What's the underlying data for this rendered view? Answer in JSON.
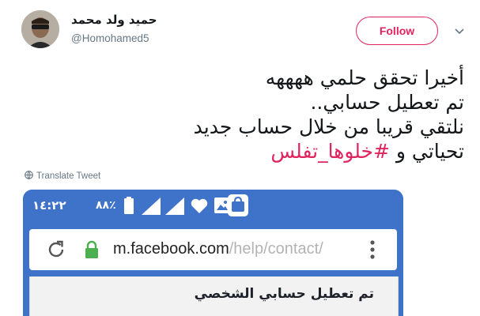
{
  "user": {
    "display_name": "حميد ولد محمد",
    "handle": "@Homohamed5"
  },
  "follow_label": "Follow",
  "tweet": {
    "lines": [
      "أخيرا تحقق حلمي ههههه",
      "تم تعطيل حسابي..",
      "نلتقي قريبا من خلال حساب جديد"
    ],
    "last_line_prefix": "تحياتي و ",
    "hashtag": "#خلوها_تفلس"
  },
  "translate_label": "Translate Tweet",
  "screenshot": {
    "status_time": "١٤:٢٢",
    "battery_percent": "٨٨٪",
    "url_domain": "m.facebook.com",
    "url_path": "/help/contact/",
    "page_heading": "تم تعطيل حسابي الشخصي"
  },
  "colors": {
    "accent": "#e0245e",
    "facebook_blue": "#3f72c9",
    "lock_green": "#4caf50"
  }
}
